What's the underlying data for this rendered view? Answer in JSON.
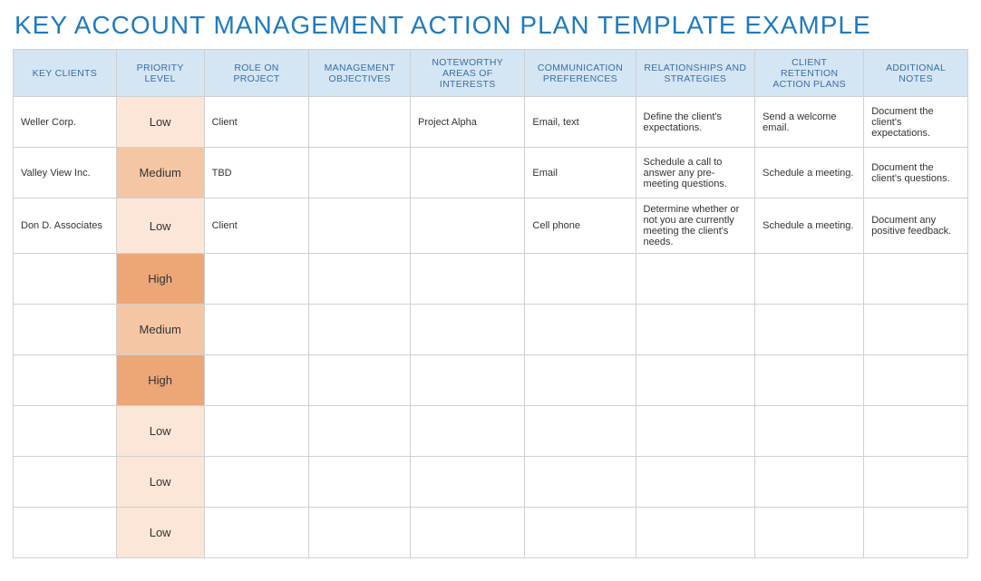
{
  "title": "KEY ACCOUNT MANAGEMENT ACTION PLAN TEMPLATE EXAMPLE",
  "headers": [
    "KEY CLIENTS",
    "PRIORITY LEVEL",
    "ROLE ON PROJECT",
    "MANAGEMENT OBJECTIVES",
    "NOTEWORTHY AREAS OF INTERESTS",
    "COMMUNICATION PREFERENCES",
    "RELATIONSHIPS AND STRATEGIES",
    "CLIENT RETENTION ACTION PLANS",
    "ADDITIONAL NOTES"
  ],
  "rows": [
    {
      "key_clients": "Weller Corp.",
      "priority": "Low",
      "role": "Client",
      "objectives": "",
      "interests": "Project Alpha",
      "communication": "Email, text",
      "relationships": "Define the client's expectations.",
      "retention": "Send a welcome email.",
      "notes": "Document the client's expectations."
    },
    {
      "key_clients": "Valley View Inc.",
      "priority": "Medium",
      "role": "TBD",
      "objectives": "",
      "interests": "",
      "communication": "Email",
      "relationships": "Schedule a call to answer any pre-meeting questions.",
      "retention": "Schedule a meeting.",
      "notes": "Document the client's questions."
    },
    {
      "key_clients": "Don D. Associates",
      "priority": "Low",
      "role": "Client",
      "objectives": "",
      "interests": "",
      "communication": "Cell phone",
      "relationships": "Determine whether or not you are currently meeting the client's needs.",
      "retention": "Schedule a meeting.",
      "notes": "Document any positive feedback."
    },
    {
      "key_clients": "",
      "priority": "High",
      "role": "",
      "objectives": "",
      "interests": "",
      "communication": "",
      "relationships": "",
      "retention": "",
      "notes": ""
    },
    {
      "key_clients": "",
      "priority": "Medium",
      "role": "",
      "objectives": "",
      "interests": "",
      "communication": "",
      "relationships": "",
      "retention": "",
      "notes": ""
    },
    {
      "key_clients": "",
      "priority": "High",
      "role": "",
      "objectives": "",
      "interests": "",
      "communication": "",
      "relationships": "",
      "retention": "",
      "notes": ""
    },
    {
      "key_clients": "",
      "priority": "Low",
      "role": "",
      "objectives": "",
      "interests": "",
      "communication": "",
      "relationships": "",
      "retention": "",
      "notes": ""
    },
    {
      "key_clients": "",
      "priority": "Low",
      "role": "",
      "objectives": "",
      "interests": "",
      "communication": "",
      "relationships": "",
      "retention": "",
      "notes": ""
    },
    {
      "key_clients": "",
      "priority": "Low",
      "role": "",
      "objectives": "",
      "interests": "",
      "communication": "",
      "relationships": "",
      "retention": "",
      "notes": ""
    }
  ]
}
